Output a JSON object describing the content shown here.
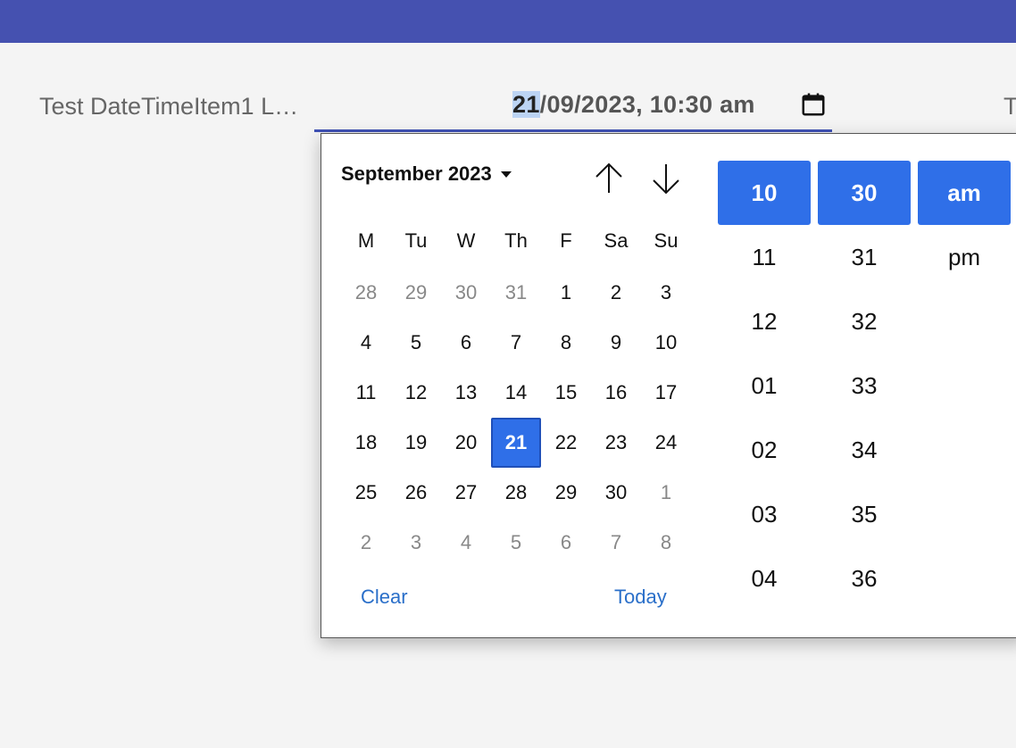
{
  "field": {
    "label": "Test DateTimeItem1 L…",
    "value_day": "21",
    "value_rest": "/09/2023, 10:30 am",
    "next_label_cut": "T"
  },
  "calendar": {
    "month_label": "September 2023",
    "weekdays": [
      "M",
      "Tu",
      "W",
      "Th",
      "F",
      "Sa",
      "Su"
    ],
    "weeks": [
      [
        {
          "d": "28",
          "o": true
        },
        {
          "d": "29",
          "o": true
        },
        {
          "d": "30",
          "o": true
        },
        {
          "d": "31",
          "o": true
        },
        {
          "d": "1"
        },
        {
          "d": "2"
        },
        {
          "d": "3"
        }
      ],
      [
        {
          "d": "4"
        },
        {
          "d": "5"
        },
        {
          "d": "6"
        },
        {
          "d": "7"
        },
        {
          "d": "8"
        },
        {
          "d": "9"
        },
        {
          "d": "10"
        }
      ],
      [
        {
          "d": "11"
        },
        {
          "d": "12"
        },
        {
          "d": "13"
        },
        {
          "d": "14"
        },
        {
          "d": "15"
        },
        {
          "d": "16"
        },
        {
          "d": "17"
        }
      ],
      [
        {
          "d": "18"
        },
        {
          "d": "19"
        },
        {
          "d": "20"
        },
        {
          "d": "21",
          "s": true
        },
        {
          "d": "22"
        },
        {
          "d": "23"
        },
        {
          "d": "24"
        }
      ],
      [
        {
          "d": "25"
        },
        {
          "d": "26"
        },
        {
          "d": "27"
        },
        {
          "d": "28"
        },
        {
          "d": "29"
        },
        {
          "d": "30"
        },
        {
          "d": "1",
          "o": true
        }
      ],
      [
        {
          "d": "2",
          "o": true
        },
        {
          "d": "3",
          "o": true
        },
        {
          "d": "4",
          "o": true
        },
        {
          "d": "5",
          "o": true
        },
        {
          "d": "6",
          "o": true
        },
        {
          "d": "7",
          "o": true
        },
        {
          "d": "8",
          "o": true
        }
      ]
    ],
    "clear_label": "Clear",
    "today_label": "Today"
  },
  "time": {
    "hour_selected": "10",
    "minute_selected": "30",
    "ampm_selected": "am",
    "hours": [
      "11",
      "12",
      "01",
      "02",
      "03",
      "04"
    ],
    "minutes": [
      "31",
      "32",
      "33",
      "34",
      "35",
      "36"
    ],
    "ampm": [
      "pm"
    ]
  },
  "colors": {
    "topbar": "#4551b0",
    "accent": "#2f6fe8",
    "link": "#2a6fc9"
  }
}
